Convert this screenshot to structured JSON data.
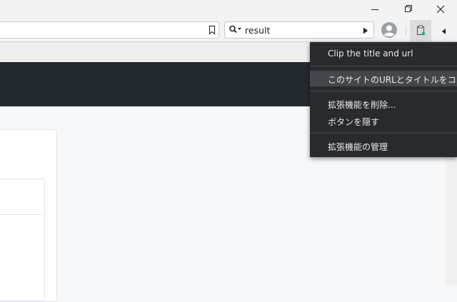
{
  "search": {
    "query": "result"
  },
  "menu": {
    "items": [
      {
        "label": "Clip the title and url"
      },
      {
        "label": "このサイトのURLとタイトルをコピー"
      },
      {
        "label": "拡張機能を削除..."
      },
      {
        "label": "ボタンを隠す"
      },
      {
        "label": "拡張機能の管理"
      }
    ]
  },
  "colors": {
    "header_dark": "#24292e",
    "menu_bg": "#292a2d",
    "menu_highlight": "#44464b",
    "extension_accent": "#2aa89a"
  },
  "icons": {
    "minimize": "minimize-icon",
    "restore": "restore-icon",
    "close": "close-icon",
    "bookmark": "bookmark-icon",
    "search": "search-dropdown-icon",
    "go": "play-arrow-icon",
    "profile": "profile-avatar-icon",
    "extension": "clipboard-extension-icon",
    "overflow": "chevron-left-icon"
  }
}
